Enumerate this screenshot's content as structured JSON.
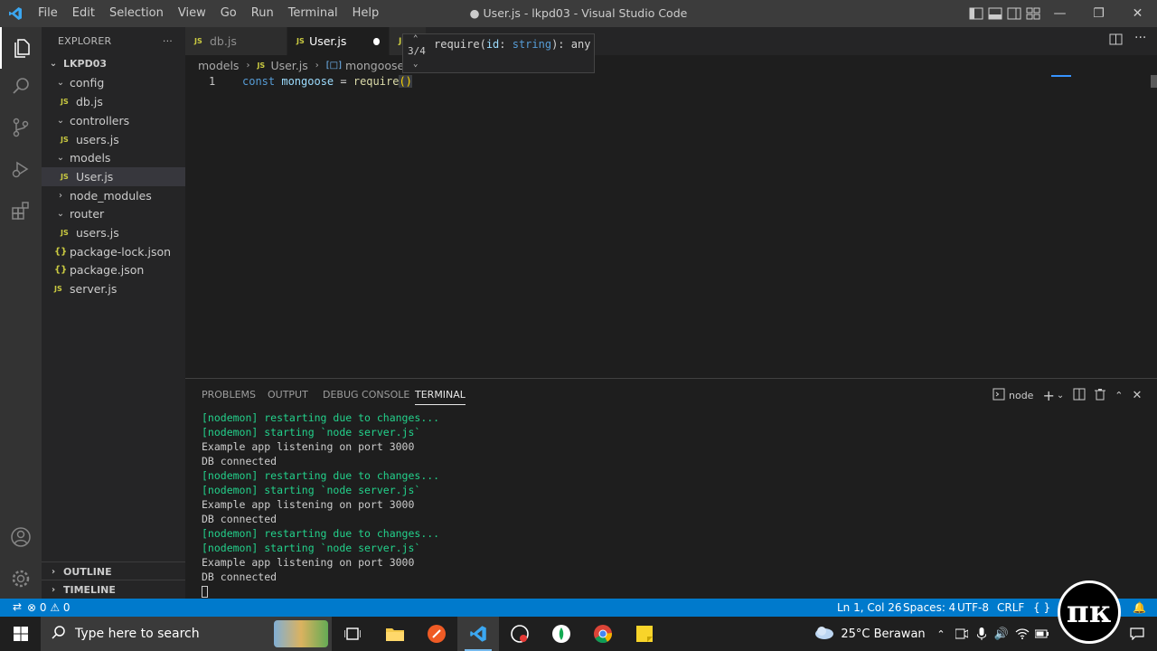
{
  "titlebar": {
    "menu": [
      "File",
      "Edit",
      "Selection",
      "View",
      "Go",
      "Run",
      "Terminal",
      "Help"
    ],
    "title": "● User.js - lkpd03 - Visual Studio Code"
  },
  "sidebar": {
    "header": "EXPLORER",
    "more": "···",
    "root": "LKPD03",
    "items": [
      {
        "label": "config"
      },
      {
        "label": "db.js"
      },
      {
        "label": "controllers"
      },
      {
        "label": "users.js"
      },
      {
        "label": "models"
      },
      {
        "label": "User.js"
      },
      {
        "label": "node_modules"
      },
      {
        "label": "router"
      },
      {
        "label": "users.js"
      },
      {
        "label": "package-lock.json"
      },
      {
        "label": "package.json"
      },
      {
        "label": "server.js"
      }
    ],
    "outline": "OUTLINE",
    "timeline": "TIMELINE",
    "js_badge": "JS",
    "json_badge": "{}"
  },
  "tabs": [
    {
      "label": "db.js"
    },
    {
      "label": "User.js"
    },
    {
      "label": "J"
    }
  ],
  "breadcrumb": [
    "models",
    "User.js",
    "mongoose"
  ],
  "editor": {
    "line_number": "1",
    "tokens": {
      "kw": "const",
      "var": "mongoose",
      "op": "=",
      "fn": "require",
      "paren": "()"
    }
  },
  "hint": {
    "counter": "3/4",
    "signature_fn": "require",
    "signature_param": "id",
    "signature_type": "string",
    "signature_ret": "any"
  },
  "panel": {
    "tabs": [
      "PROBLEMS",
      "OUTPUT",
      "DEBUG CONSOLE",
      "TERMINAL"
    ],
    "shell": "node",
    "terminal_lines": [
      {
        "text": "[nodemon] restarting due to changes...",
        "color": "green"
      },
      {
        "text": "[nodemon] starting `node server.js`",
        "color": "green"
      },
      {
        "text": "Example app listening on port 3000",
        "color": "white"
      },
      {
        "text": "DB connected",
        "color": "white"
      },
      {
        "text": "[nodemon] restarting due to changes...",
        "color": "green"
      },
      {
        "text": "[nodemon] starting `node server.js`",
        "color": "green"
      },
      {
        "text": "Example app listening on port 3000",
        "color": "white"
      },
      {
        "text": "DB connected",
        "color": "white"
      },
      {
        "text": "[nodemon] restarting due to changes...",
        "color": "green"
      },
      {
        "text": "[nodemon] starting `node server.js`",
        "color": "green"
      },
      {
        "text": "Example app listening on port 3000",
        "color": "white"
      },
      {
        "text": "DB connected",
        "color": "white"
      }
    ]
  },
  "status": {
    "errors": "⊗ 0 ⚠ 0",
    "position": "Ln 1, Col 26",
    "spaces": "Spaces: 4",
    "encoding": "UTF-8",
    "eol": "CRLF",
    "lang": "{ }"
  },
  "taskbar": {
    "search_placeholder": "Type here to search",
    "weather": "25°C  Berawan"
  },
  "watermark": "πκ",
  "colors": {
    "accent": "#007acc",
    "editor_bg": "#1e1e1e",
    "sidebar_bg": "#252526",
    "terminal_green": "#23d18b"
  }
}
